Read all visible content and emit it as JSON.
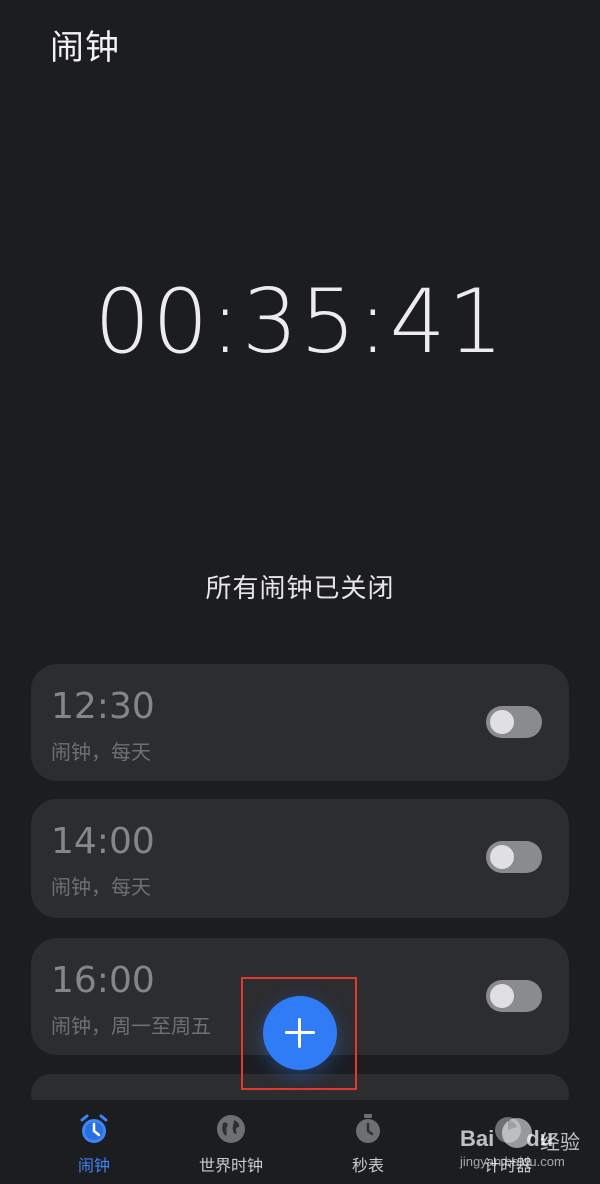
{
  "header": {
    "title": "闹钟"
  },
  "clock": {
    "time": "00:35:41"
  },
  "status": {
    "text": "所有闹钟已关闭"
  },
  "alarms": [
    {
      "time": "12:30",
      "desc": "闹钟，每天",
      "enabled": false
    },
    {
      "time": "14:00",
      "desc": "闹钟，每天",
      "enabled": false
    },
    {
      "time": "16:00",
      "desc": "闹钟，周一至周五",
      "enabled": false
    }
  ],
  "fab": {
    "icon": "plus-icon"
  },
  "nav": {
    "items": [
      {
        "label": "闹钟",
        "icon": "alarm-clock-icon",
        "active": true
      },
      {
        "label": "世界时钟",
        "icon": "globe-icon",
        "active": false
      },
      {
        "label": "秒表",
        "icon": "stopwatch-icon",
        "active": false
      },
      {
        "label": "计时器",
        "icon": "timer-icon",
        "active": false
      }
    ]
  },
  "watermark": {
    "brand": "Bai",
    "brand2": "du",
    "suffix": "经验",
    "url": "jingyan.baidu.com"
  },
  "colors": {
    "accent": "#2f7cf6",
    "highlight": "#e23a2a",
    "background": "#1c1d21",
    "card": "#2c2d31"
  }
}
